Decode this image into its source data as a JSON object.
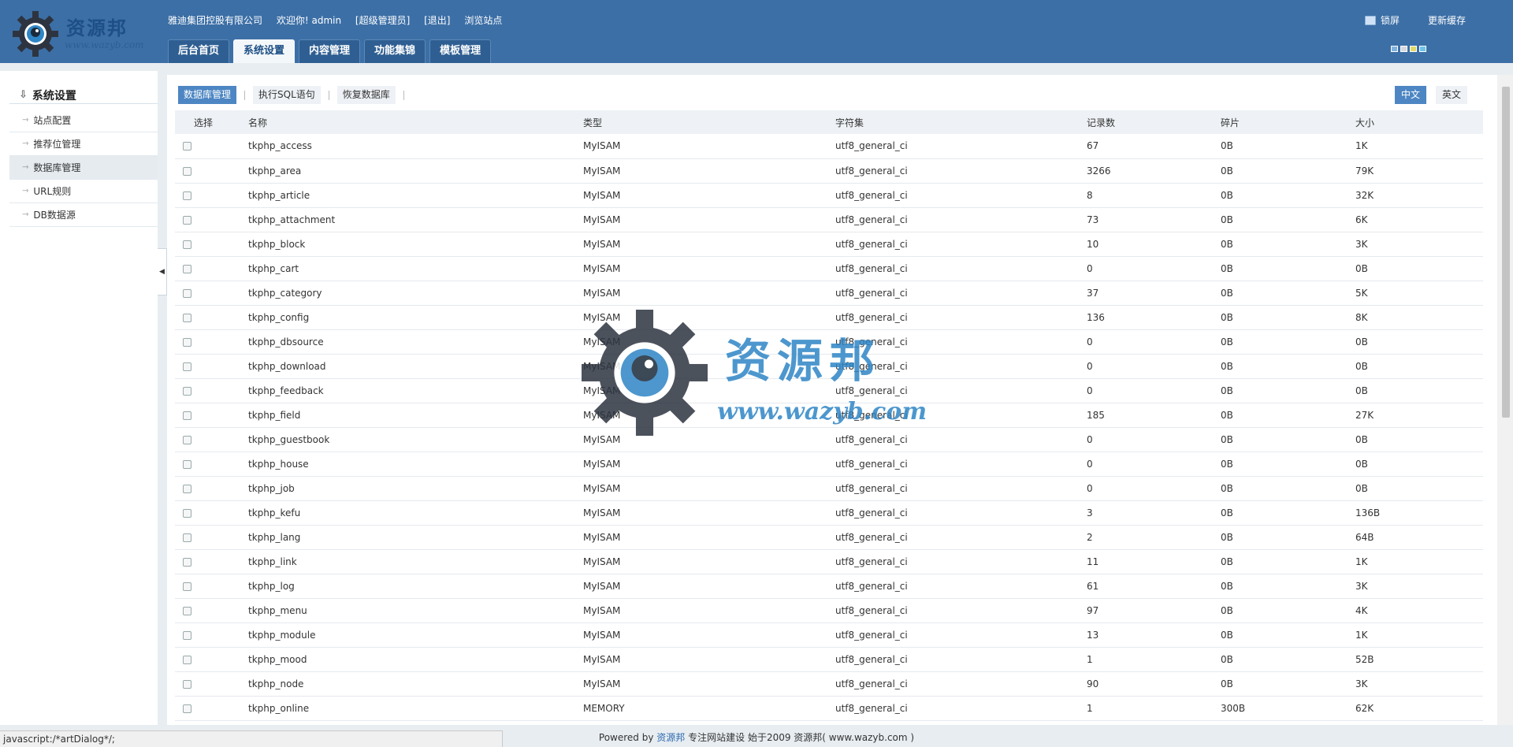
{
  "header": {
    "logo_text": "资源邦",
    "logo_url": "www.wazyb.com",
    "company": "雅迪集团控股有限公司",
    "welcome": "欢迎你! admin",
    "role": "[超级管理员]",
    "logout": "[退出]",
    "browse": "浏览站点",
    "lock_label": "锁屏",
    "refresh_label": "更新缓存",
    "skin_colors": [
      "#7fb2de",
      "#d5d9dd",
      "#e0da6b",
      "#6fc3e8"
    ]
  },
  "nav": {
    "tabs": [
      {
        "label": "后台首页"
      },
      {
        "label": "系统设置"
      },
      {
        "label": "内容管理"
      },
      {
        "label": "功能集锦"
      },
      {
        "label": "模板管理"
      }
    ]
  },
  "sidebar": {
    "title": "系统设置",
    "items": [
      {
        "label": "站点配置"
      },
      {
        "label": "推荐位管理"
      },
      {
        "label": "数据库管理"
      },
      {
        "label": "URL规则"
      },
      {
        "label": "DB数据源"
      }
    ]
  },
  "toolbar": {
    "db_manage": "数据库管理",
    "exec_sql": "执行SQL语句",
    "restore_db": "恢复数据库",
    "lang_cn": "中文",
    "lang_en": "英文"
  },
  "table": {
    "headers": [
      "选择",
      "名称",
      "类型",
      "字符集",
      "记录数",
      "碎片",
      "大小"
    ],
    "rows": [
      [
        "tkphp_access",
        "MyISAM",
        "utf8_general_ci",
        "67",
        "0B",
        "1K"
      ],
      [
        "tkphp_area",
        "MyISAM",
        "utf8_general_ci",
        "3266",
        "0B",
        "79K"
      ],
      [
        "tkphp_article",
        "MyISAM",
        "utf8_general_ci",
        "8",
        "0B",
        "32K"
      ],
      [
        "tkphp_attachment",
        "MyISAM",
        "utf8_general_ci",
        "73",
        "0B",
        "6K"
      ],
      [
        "tkphp_block",
        "MyISAM",
        "utf8_general_ci",
        "10",
        "0B",
        "3K"
      ],
      [
        "tkphp_cart",
        "MyISAM",
        "utf8_general_ci",
        "0",
        "0B",
        "0B"
      ],
      [
        "tkphp_category",
        "MyISAM",
        "utf8_general_ci",
        "37",
        "0B",
        "5K"
      ],
      [
        "tkphp_config",
        "MyISAM",
        "utf8_general_ci",
        "136",
        "0B",
        "8K"
      ],
      [
        "tkphp_dbsource",
        "MyISAM",
        "utf8_general_ci",
        "0",
        "0B",
        "0B"
      ],
      [
        "tkphp_download",
        "MyISAM",
        "utf8_general_ci",
        "0",
        "0B",
        "0B"
      ],
      [
        "tkphp_feedback",
        "MyISAM",
        "utf8_general_ci",
        "0",
        "0B",
        "0B"
      ],
      [
        "tkphp_field",
        "MyISAM",
        "utf8_general_ci",
        "185",
        "0B",
        "27K"
      ],
      [
        "tkphp_guestbook",
        "MyISAM",
        "utf8_general_ci",
        "0",
        "0B",
        "0B"
      ],
      [
        "tkphp_house",
        "MyISAM",
        "utf8_general_ci",
        "0",
        "0B",
        "0B"
      ],
      [
        "tkphp_job",
        "MyISAM",
        "utf8_general_ci",
        "0",
        "0B",
        "0B"
      ],
      [
        "tkphp_kefu",
        "MyISAM",
        "utf8_general_ci",
        "3",
        "0B",
        "136B"
      ],
      [
        "tkphp_lang",
        "MyISAM",
        "utf8_general_ci",
        "2",
        "0B",
        "64B"
      ],
      [
        "tkphp_link",
        "MyISAM",
        "utf8_general_ci",
        "11",
        "0B",
        "1K"
      ],
      [
        "tkphp_log",
        "MyISAM",
        "utf8_general_ci",
        "61",
        "0B",
        "3K"
      ],
      [
        "tkphp_menu",
        "MyISAM",
        "utf8_general_ci",
        "97",
        "0B",
        "4K"
      ],
      [
        "tkphp_module",
        "MyISAM",
        "utf8_general_ci",
        "13",
        "0B",
        "1K"
      ],
      [
        "tkphp_mood",
        "MyISAM",
        "utf8_general_ci",
        "1",
        "0B",
        "52B"
      ],
      [
        "tkphp_node",
        "MyISAM",
        "utf8_general_ci",
        "90",
        "0B",
        "3K"
      ],
      [
        "tkphp_online",
        "MEMORY",
        "utf8_general_ci",
        "1",
        "300B",
        "62K"
      ]
    ]
  },
  "footer": {
    "powered_by": "Powered by",
    "brand": "资源邦",
    "rest": "专注网站建设  始于2009 资源邦( www.wazyb.com )"
  },
  "statusbar": "javascript:/*artDialog*/;",
  "watermark": {
    "text": "资源邦",
    "url": "www.wazyb.com"
  }
}
